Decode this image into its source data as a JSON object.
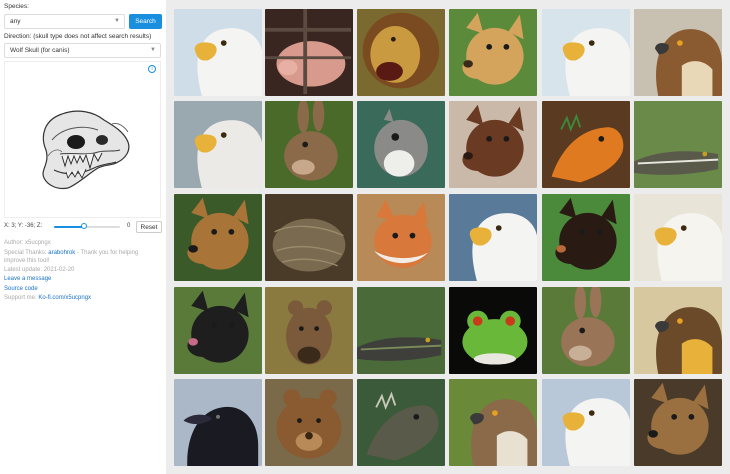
{
  "species": {
    "label": "Species:",
    "value": "any",
    "search_label": "Search"
  },
  "direction": {
    "label": "Direction: (skull type does not affect search results)",
    "value": "Wolf Skull (for canis)"
  },
  "viewer": {
    "info_icon": "info-icon"
  },
  "controls": {
    "coords": "X: 3; Y: -36; Z:",
    "slider_value": "0",
    "reset_label": "Reset",
    "slider_fraction": 0.45
  },
  "credits": {
    "author_prefix": "Author: ",
    "author": "x5ucpngx",
    "thanks_prefix": "Special Thanks: ",
    "thanks_name": "arabohrok",
    "thanks_suffix": " - Thank you for helping",
    "thanks_line2": "improve this tool!",
    "update": "Latest update: 2021-02-20",
    "leave_message": "Leave a message",
    "source_code": "Source code",
    "support_prefix": "Support me: ",
    "support_link": "Ko-fi.com/x5ucpngx"
  },
  "colors": {
    "accent": "#1a8fe0",
    "link": "#1a73c8"
  },
  "grid": [
    {
      "subject": "bald eagle head",
      "bg": "#cfdde8",
      "fg": "#f4f4f2",
      "accent": "#e8b23a",
      "kind": "eagle"
    },
    {
      "subject": "pig behind bars",
      "bg": "#3a2620",
      "fg": "#d89a8c",
      "accent": "#5a4a40",
      "kind": "pig"
    },
    {
      "subject": "roaring lion",
      "bg": "#7a6a30",
      "fg": "#c99a40",
      "accent": "#7a4a20",
      "kind": "lion"
    },
    {
      "subject": "yellow labrador",
      "bg": "#5a8a3a",
      "fg": "#d4a45c",
      "accent": "#3a2a1a",
      "kind": "dog"
    },
    {
      "subject": "bald eagle head",
      "bg": "#d8e4ec",
      "fg": "#f4f4f2",
      "accent": "#e8b23a",
      "kind": "eagle"
    },
    {
      "subject": "red-tailed hawk",
      "bg": "#c8c0b0",
      "fg": "#8a5a30",
      "accent": "#e8d8b8",
      "kind": "hawk"
    },
    {
      "subject": "bald eagle behind fence",
      "bg": "#9aa8b0",
      "fg": "#eceae6",
      "accent": "#e8b23a",
      "kind": "eagle"
    },
    {
      "subject": "wild rabbit",
      "bg": "#4a6a2a",
      "fg": "#8a6a48",
      "accent": "#c8a88a",
      "kind": "rabbit"
    },
    {
      "subject": "squirrel",
      "bg": "#3a6a5a",
      "fg": "#8a8a88",
      "accent": "#eeeeea",
      "kind": "squirrel"
    },
    {
      "subject": "doberman",
      "bg": "#cab8a8",
      "fg": "#6a3a22",
      "accent": "#2a1a12",
      "kind": "dog"
    },
    {
      "subject": "orange iguana",
      "bg": "#5a3a20",
      "fg": "#e07a20",
      "accent": "#3a8a3a",
      "kind": "iguana"
    },
    {
      "subject": "alligator",
      "bg": "#6a8a4a",
      "fg": "#5a5a4a",
      "accent": "#e8e8e0",
      "kind": "gator"
    },
    {
      "subject": "german shepherd",
      "bg": "#3a5a2a",
      "fg": "#a87438",
      "accent": "#1a1a1a",
      "kind": "dog"
    },
    {
      "subject": "rabbit in nest",
      "bg": "#4a3a28",
      "fg": "#7a6a50",
      "accent": "#9a8a6a",
      "kind": "nest"
    },
    {
      "subject": "red fox",
      "bg": "#b88a58",
      "fg": "#d8783a",
      "accent": "#f4ece4",
      "kind": "fox"
    },
    {
      "subject": "bald eagle head",
      "bg": "#5a7a9a",
      "fg": "#f4f4f2",
      "accent": "#e8b23a",
      "kind": "eagle"
    },
    {
      "subject": "doberman smiling",
      "bg": "#4a8a3a",
      "fg": "#2a1a14",
      "accent": "#b86a3a",
      "kind": "dog"
    },
    {
      "subject": "bald eagle head",
      "bg": "#e8e4d8",
      "fg": "#f6f4ee",
      "accent": "#e8b23a",
      "kind": "eagle"
    },
    {
      "subject": "black german shepherd",
      "bg": "#5a7a3a",
      "fg": "#1e1e1e",
      "accent": "#c86a8a",
      "kind": "dog"
    },
    {
      "subject": "hyena",
      "bg": "#8a7a40",
      "fg": "#7a5a3a",
      "accent": "#3a2a1a",
      "kind": "hyena"
    },
    {
      "subject": "crocodile in grass",
      "bg": "#4a6a3a",
      "fg": "#3e3e3a",
      "accent": "#7a8a5a",
      "kind": "gator"
    },
    {
      "subject": "green tree frog",
      "bg": "#0a0a08",
      "fg": "#6ab83a",
      "accent": "#e8e8e0",
      "kind": "frog"
    },
    {
      "subject": "cottontail rabbit",
      "bg": "#5a7a3a",
      "fg": "#9a7456",
      "accent": "#c8b098",
      "kind": "rabbit"
    },
    {
      "subject": "golden eagle",
      "bg": "#d8c8a0",
      "fg": "#6a4a28",
      "accent": "#e8b23a",
      "kind": "hawk"
    },
    {
      "subject": "raven",
      "bg": "#aab8c8",
      "fg": "#1a1a22",
      "accent": "#2a2a3a",
      "kind": "raven"
    },
    {
      "subject": "brown bear",
      "bg": "#7a6a4a",
      "fg": "#8a5a30",
      "accent": "#3a2412",
      "kind": "bear"
    },
    {
      "subject": "monitor lizard",
      "bg": "#3a5a3a",
      "fg": "#5a5a4a",
      "accent": "#c8c8b8",
      "kind": "iguana"
    },
    {
      "subject": "hawk",
      "bg": "#6a8a3a",
      "fg": "#8a6a48",
      "accent": "#e8e0d0",
      "kind": "hawk"
    },
    {
      "subject": "bald eagle head",
      "bg": "#b8c8d8",
      "fg": "#f4f4f2",
      "accent": "#e8b23a",
      "kind": "eagle"
    },
    {
      "subject": "german shepherd",
      "bg": "#4a3a2a",
      "fg": "#9a7040",
      "accent": "#1a1a1a",
      "kind": "dog"
    }
  ]
}
